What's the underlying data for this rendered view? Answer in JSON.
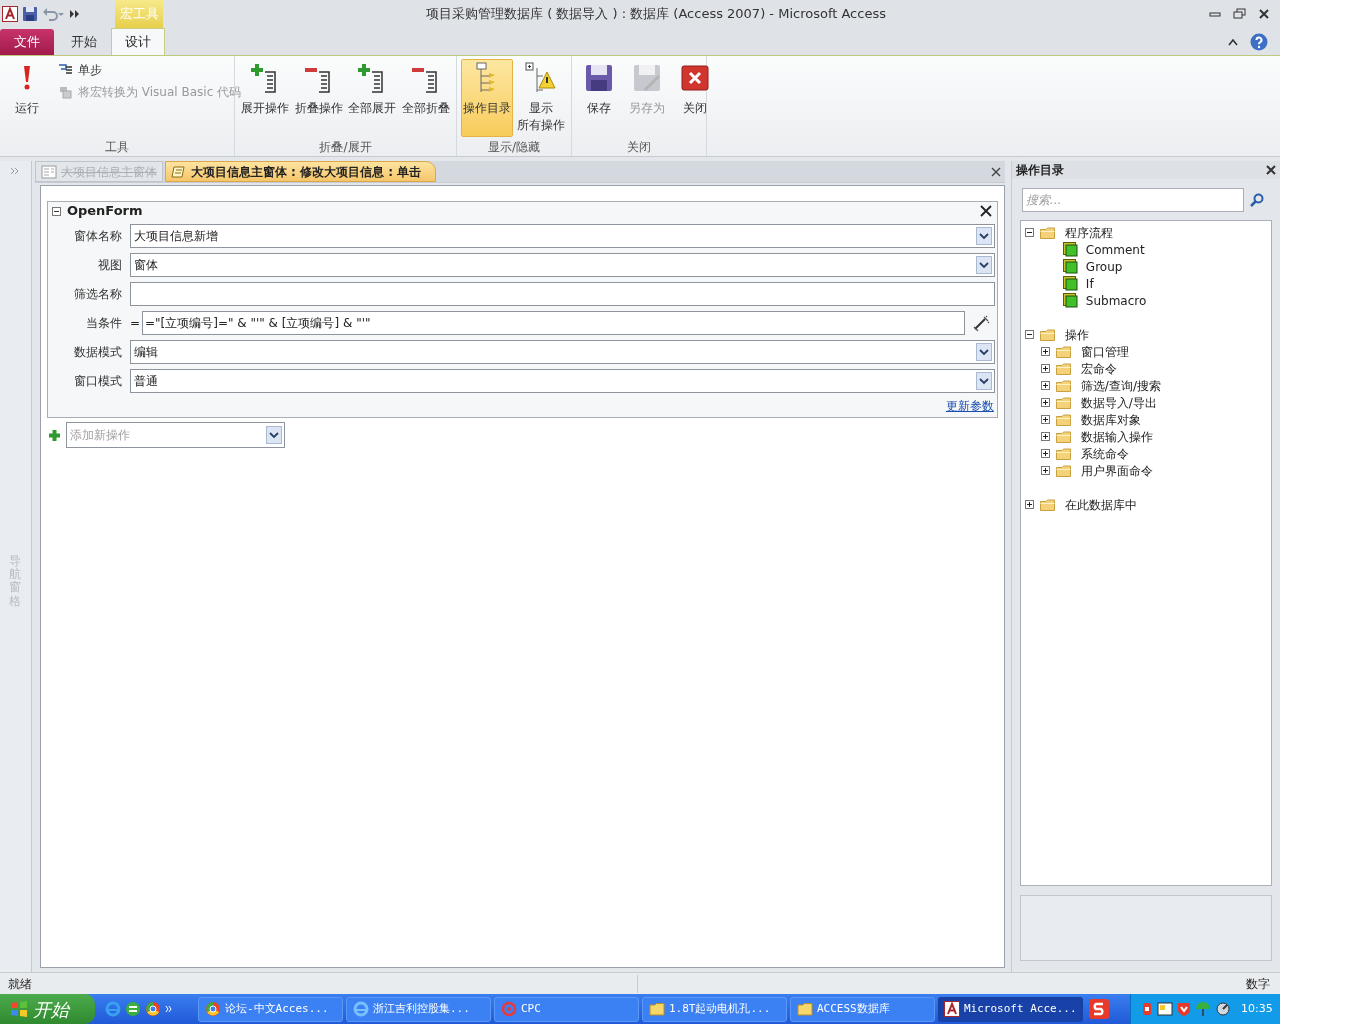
{
  "window": {
    "title": "项目采购管理数据库 ( 数据导入 ) : 数据库 (Access 2007)  -  Microsoft Access",
    "contextual_tab": "宏工具"
  },
  "ribbon_tabs": [
    {
      "label": "文件",
      "kind": "file",
      "selected": false
    },
    {
      "label": "开始",
      "kind": "tab",
      "selected": false
    },
    {
      "label": "设计",
      "kind": "tab",
      "selected": true
    }
  ],
  "ribbon_groups": [
    {
      "label": "工具",
      "buttons": [
        {
          "kind": "run",
          "label": "运行",
          "disabled": false
        },
        {
          "kind": "step",
          "label": "单步",
          "disabled": false
        },
        {
          "kind": "convert",
          "label": "将宏转换为 Visual Basic 代码",
          "disabled": true
        }
      ]
    },
    {
      "label": "折叠/展开",
      "buttons": [
        {
          "kind": "expand",
          "label": "展开操作",
          "disabled": false
        },
        {
          "kind": "collapse",
          "label": "折叠操作",
          "disabled": false
        },
        {
          "kind": "expand",
          "label": "全部展开",
          "disabled": false
        },
        {
          "kind": "collapse",
          "label": "全部折叠",
          "disabled": false
        }
      ]
    },
    {
      "label": "显示/隐藏",
      "buttons": [
        {
          "kind": "catalog",
          "label": "操作目录",
          "selected": true,
          "disabled": false
        },
        {
          "kind": "showall",
          "label": "显示",
          "label_2": "所有操作",
          "selected": false,
          "disabled": false
        }
      ]
    },
    {
      "label": "关闭",
      "buttons": [
        {
          "kind": "save",
          "label": "保存",
          "disabled": false
        },
        {
          "kind": "saveas",
          "label": "另存为",
          "disabled": true
        },
        {
          "kind": "close",
          "label": "关闭",
          "disabled": false
        }
      ]
    }
  ],
  "nav_pane": {
    "label": "导航窗格"
  },
  "document_tabs": [
    {
      "label": "大项目信息主窗体",
      "kind": "form",
      "selected": false
    },
    {
      "label": "大项目信息主窗体 : 修改大项目信息 : 单击",
      "kind": "macro",
      "selected": true
    }
  ],
  "macro_action": {
    "name": "OpenForm",
    "expanded": true,
    "arguments": [
      {
        "label": "窗体名称",
        "kind": "dropdown",
        "value": "大项目信息新增"
      },
      {
        "label": "视图",
        "kind": "dropdown",
        "value": "窗体"
      },
      {
        "label": "筛选名称",
        "kind": "text"
      },
      {
        "label": "当条件",
        "kind": "expression",
        "prefix": "=",
        "value": "=\"[立项编号]=\" & \"'\" & [立项编号] & \"'\""
      },
      {
        "label": "数据模式",
        "kind": "dropdown",
        "value": "编辑"
      },
      {
        "label": "窗口模式",
        "kind": "dropdown",
        "value": "普通"
      }
    ],
    "update_link": "更新参数"
  },
  "add_action": {
    "placeholder": "添加新操作"
  },
  "action_catalog": {
    "title": "操作目录",
    "search_placeholder": "搜索...",
    "tree": [
      {
        "label": "程序流程",
        "kind": "folder",
        "expanded": true,
        "children": [
          {
            "label": "Comment",
            "kind": "block"
          },
          {
            "label": "Group",
            "kind": "block"
          },
          {
            "label": "If",
            "kind": "block"
          },
          {
            "label": "Submacro",
            "kind": "block"
          }
        ]
      },
      {
        "label": "操作",
        "kind": "folder",
        "expanded": true,
        "children": [
          {
            "label": "窗口管理",
            "kind": "folder",
            "expanded": false
          },
          {
            "label": "宏命令",
            "kind": "folder",
            "expanded": false
          },
          {
            "label": "筛选/查询/搜索",
            "kind": "folder",
            "expanded": false
          },
          {
            "label": "数据导入/导出",
            "kind": "folder",
            "expanded": false
          },
          {
            "label": "数据库对象",
            "kind": "folder",
            "expanded": false
          },
          {
            "label": "数据输入操作",
            "kind": "folder",
            "expanded": false
          },
          {
            "label": "系统命令",
            "kind": "folder",
            "expanded": false
          },
          {
            "label": "用户界面命令",
            "kind": "folder",
            "expanded": false
          }
        ]
      },
      {
        "label": "在此数据库中",
        "kind": "folder",
        "expanded": false
      }
    ]
  },
  "status_bar": {
    "left": "就绪",
    "right": "数字"
  },
  "taskbar": {
    "start": "开始",
    "tasks": [
      {
        "label": "论坛-中文Acces...",
        "kind": "chrome",
        "selected": false
      },
      {
        "label": "浙江吉利控股集...",
        "kind": "ie",
        "selected": false
      },
      {
        "label": "CPC",
        "kind": "cpc",
        "selected": false
      },
      {
        "label": "1.8T起动电机孔...",
        "kind": "folder",
        "selected": false
      },
      {
        "label": "ACCESS数据库",
        "kind": "folder",
        "selected": false
      },
      {
        "label": "Microsoft Acce...",
        "kind": "access",
        "selected": true
      }
    ],
    "clock": "10:35"
  }
}
